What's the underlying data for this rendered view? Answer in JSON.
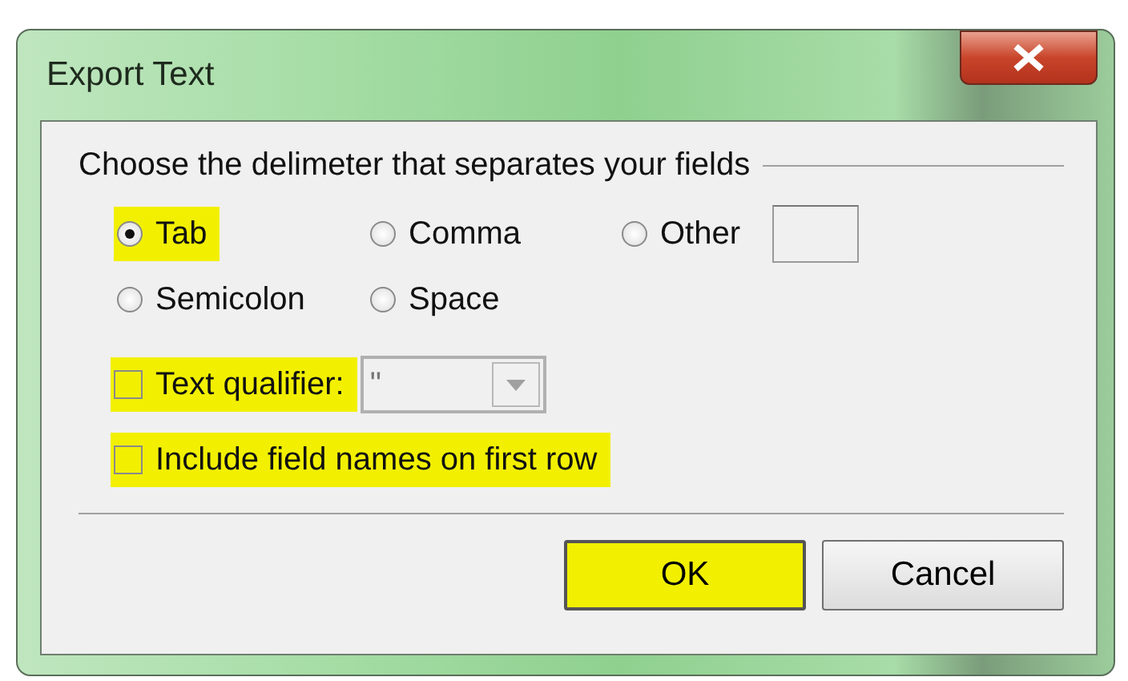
{
  "window": {
    "title": "Export Text"
  },
  "delimiter_group": {
    "label": "Choose the delimeter that separates your fields",
    "options": [
      {
        "label": "Tab",
        "selected": true,
        "highlighted": true,
        "kind": "plain"
      },
      {
        "label": "Comma",
        "selected": false,
        "highlighted": false,
        "kind": "plain"
      },
      {
        "label": "Other",
        "selected": false,
        "highlighted": false,
        "kind": "with_field"
      },
      {
        "label": "Semicolon",
        "selected": false,
        "highlighted": false,
        "kind": "plain"
      },
      {
        "label": "Space",
        "selected": false,
        "highlighted": false,
        "kind": "plain"
      }
    ]
  },
  "text_qualifier": {
    "label": "Text qualifier:",
    "checked": false,
    "highlighted": true,
    "value": "\"",
    "disabled": true
  },
  "include_field_names": {
    "label": "Include field names on first row",
    "checked": false,
    "highlighted": true
  },
  "buttons": [
    {
      "label": "OK",
      "highlighted": true,
      "default": true
    },
    {
      "label": "Cancel",
      "highlighted": false,
      "default": false
    }
  ]
}
